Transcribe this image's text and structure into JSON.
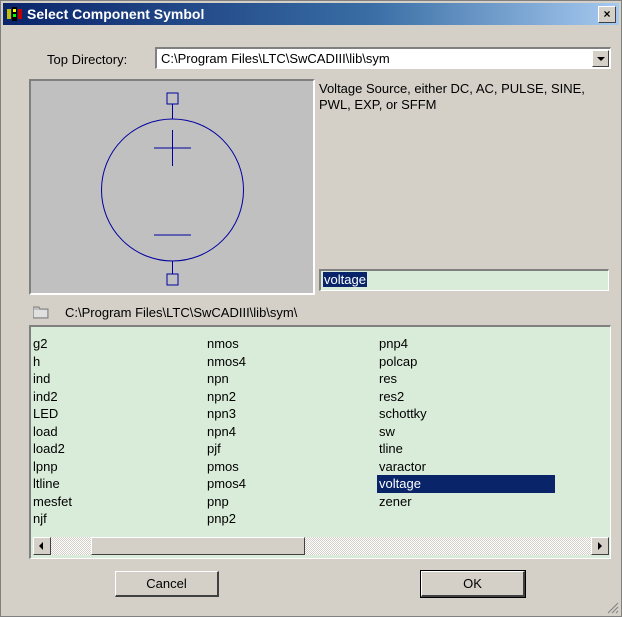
{
  "window": {
    "title": "Select Component Symbol",
    "close_label": "×"
  },
  "top_directory": {
    "label": "Top Directory:",
    "value": "C:\\Program Files\\LTC\\SwCADIII\\lib\\sym"
  },
  "symbol": {
    "description": "Voltage Source, either DC, AC, PULSE, SINE, PWL, EXP, or SFFM",
    "name_value": "voltage"
  },
  "current_path": "C:\\Program Files\\LTC\\SwCADIII\\lib\\sym\\",
  "list": {
    "columns": [
      [
        "g2",
        "h",
        "ind",
        "ind2",
        "LED",
        "load",
        "load2",
        "lpnp",
        "ltline",
        "mesfet",
        "njf"
      ],
      [
        "nmos",
        "nmos4",
        "npn",
        "npn2",
        "npn3",
        "npn4",
        "pjf",
        "pmos",
        "pmos4",
        "pnp",
        "pnp2"
      ],
      [
        "pnp4",
        "polcap",
        "res",
        "res2",
        "schottky",
        "sw",
        "tline",
        "varactor",
        "voltage",
        "zener"
      ]
    ],
    "selected": "voltage"
  },
  "buttons": {
    "cancel": "Cancel",
    "ok": "OK"
  },
  "colors": {
    "symbol_stroke": "#0000a0",
    "selection": "#0a246a",
    "list_background": "#d9ecd9"
  }
}
